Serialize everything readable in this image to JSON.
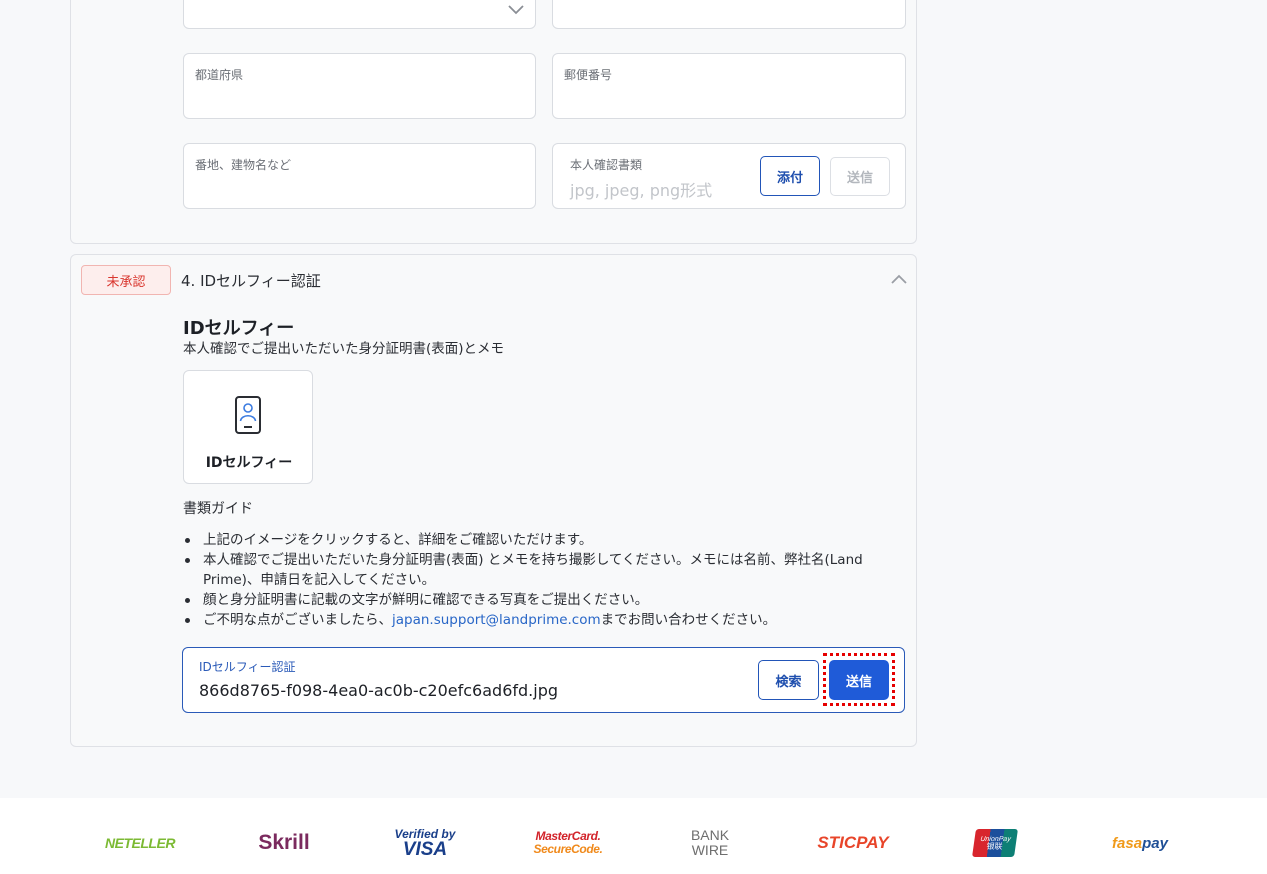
{
  "address_section": {
    "prefecture_label": "都道府県",
    "postal_code_label": "郵便番号",
    "street_label": "番地、建物名など",
    "id_doc_label": "本人確認書類",
    "id_doc_placeholder": "jpg, jpeg, png形式",
    "attach_button": "添付",
    "send_button": "送信"
  },
  "selfie_section": {
    "status_badge": "未承認",
    "header_title": "4. IDセルフィー認証",
    "heading": "IDセルフィー",
    "subheading": "本人確認でご提出いただいた身分証明書(表面)とメモ",
    "thumbnail_label": "IDセルフィー",
    "guide_title": "書類ガイド",
    "guide_items": [
      "上記のイメージをクリックすると、詳細をご確認いただけます。",
      "本人確認でご提出いただいた身分証明書(表面) とメモを持ち撮影してください。メモには名前、弊社名(Land Prime)、申請日を記入してください。",
      "顔と身分証明書に記載の文字が鮮明に確認できる写真をご提出ください。"
    ],
    "contact_prefix": "ご不明な点がございましたら、",
    "contact_email": "japan.support@landprime.com",
    "contact_suffix": "までお問い合わせください。",
    "file_field_label": "IDセルフィー認証",
    "file_field_value": "866d8765-f098-4ea0-ac0b-c20efc6ad6fd.jpg",
    "search_button": "検索",
    "send_button": "送信"
  },
  "footer_logos": {
    "neteller": "NETELLER",
    "skrill": "Skrill",
    "visa_top": "Verified by",
    "visa_bottom": "VISA",
    "mc_top": "MasterCard.",
    "mc_bottom": "SecureCode.",
    "bank_top": "BANK",
    "bank_bottom": "WIRE",
    "sticpay": "STICPAY",
    "unionpay_top": "UnionPay",
    "unionpay_bottom": "银联",
    "fasapay_a": "fasa",
    "fasapay_b": "pay"
  },
  "colors": {
    "primary": "#1f5bd8",
    "badge_red": "#d9372f",
    "highlight": "#e60000"
  }
}
